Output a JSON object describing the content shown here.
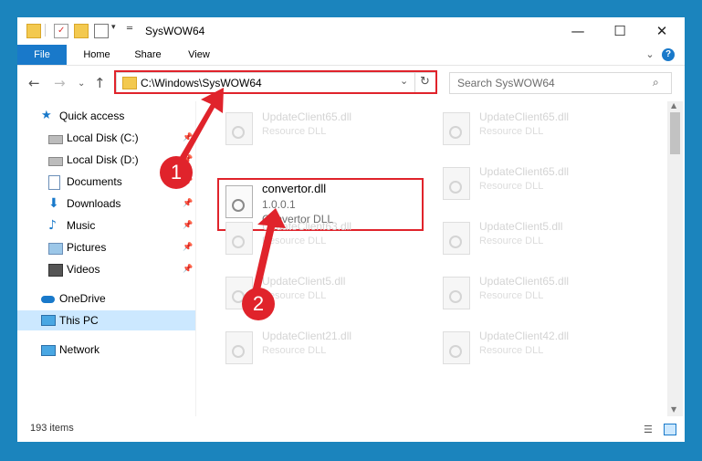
{
  "window": {
    "title": "SysWOW64",
    "controls": [
      "minimize-icon",
      "maximize-icon",
      "close-icon"
    ]
  },
  "ribbon": {
    "tabs": [
      "File",
      "Home",
      "Share",
      "View"
    ],
    "help_icon": "help-icon"
  },
  "nav": {
    "address": "C:\\Windows\\SysWOW64",
    "search_placeholder": "Search SysWOW64"
  },
  "sidebar": {
    "items": [
      {
        "label": "Quick access",
        "icon": "star-icon",
        "pinned": false
      },
      {
        "label": "Local Disk (C:)",
        "icon": "drive-icon",
        "pinned": true
      },
      {
        "label": "Local Disk (D:)",
        "icon": "drive-icon",
        "pinned": true
      },
      {
        "label": "Documents",
        "icon": "documents-icon",
        "pinned": true
      },
      {
        "label": "Downloads",
        "icon": "download-icon",
        "pinned": true
      },
      {
        "label": "Music",
        "icon": "music-icon",
        "pinned": true
      },
      {
        "label": "Pictures",
        "icon": "pictures-icon",
        "pinned": true
      },
      {
        "label": "Videos",
        "icon": "videos-icon",
        "pinned": true
      },
      {
        "label": "OneDrive",
        "icon": "cloud-icon",
        "pinned": false
      },
      {
        "label": "This PC",
        "icon": "computer-icon",
        "pinned": false,
        "selected": true
      },
      {
        "label": "Network",
        "icon": "network-icon",
        "pinned": false
      }
    ]
  },
  "files": {
    "tiles": [
      {
        "name": "UpdateClient65.dll",
        "type": "Resource DLL"
      },
      {
        "name": "UpdateClient65.dll",
        "type": "Resource DLL"
      },
      {
        "name": "UpdateClient65.dll",
        "type": "Resource DLL"
      },
      {
        "name": "UpdateClient63.dll",
        "type": "Resource DLL"
      },
      {
        "name": "UpdateClient5.dll",
        "type": "Resource DLL"
      },
      {
        "name": "UpdateClient5.dll",
        "type": "Resource DLL"
      },
      {
        "name": "UpdateClient65.dll",
        "type": "Resource DLL"
      },
      {
        "name": "UpdateClient21.dll",
        "type": "Resource DLL"
      },
      {
        "name": "UpdateClient42.dll",
        "type": "Resource DLL"
      }
    ],
    "selected": {
      "name": "convertor.dll",
      "version": "1.0.0.1",
      "description": "Convertor DLL"
    }
  },
  "status": {
    "count": "193 items"
  },
  "annotations": {
    "badge1": "1",
    "badge2": "2",
    "color": "#e0232b"
  }
}
